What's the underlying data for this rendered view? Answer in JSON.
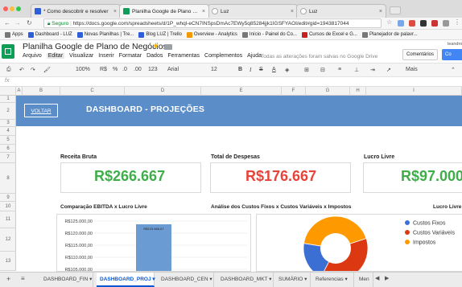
{
  "browser": {
    "tabs": [
      {
        "title": "* Como descobrir e resolver",
        "color": "#2f5fd8"
      },
      {
        "title": "Planilha Google de Plano de N",
        "color": "#0f9d58"
      },
      {
        "title": "Luz",
        "color": "#b0b0b0"
      },
      {
        "title": "Luz",
        "color": "#b0b0b0"
      }
    ],
    "secure_label": "Seguro",
    "url": "https://docs.google.com/spreadsheets/d/1P_whql-eCN7INSpsDmAc7EWy5q85284jjk1IGSFYAOI/edit#gid=1943817044",
    "bookmarks": [
      {
        "label": "Apps",
        "color": "#777"
      },
      {
        "label": "Dashboard - LUZ",
        "color": "#2f5fd8"
      },
      {
        "label": "Novas Planilhas | Tre...",
        "color": "#2f5fd8"
      },
      {
        "label": "Blog LUZ | Trello",
        "color": "#2f5fd8"
      },
      {
        "label": "Overview - Analytics",
        "color": "#f29900"
      },
      {
        "label": "Início - Painel do Co...",
        "color": "#777"
      },
      {
        "label": "Cursos de Excel e G...",
        "color": "#c5221f"
      },
      {
        "label": "Planejador de palavr...",
        "color": "#777"
      }
    ]
  },
  "sheets": {
    "doc_title": "Planilha Google de Plano de Negócios",
    "menus": [
      "Arquivo",
      "Editar",
      "Visualizar",
      "Inserir",
      "Formatar",
      "Dados",
      "Ferramentas",
      "Complementos",
      "Ajuda"
    ],
    "saved_msg": "Todas as alterações foram salvas no Google Drive",
    "comments_label": "Comentários",
    "share_label": "Co",
    "user_label": "leandro"
  },
  "toolbar": {
    "zoom": "100%",
    "currency": "R$",
    "percent": "%",
    "decimals_dec": ".0",
    "decimals_inc": ".00",
    "format_num": "123",
    "font": "Arial",
    "font_size": "12",
    "more": "Mais"
  },
  "grid": {
    "fx": "fx",
    "columns": [
      "A",
      "B",
      "C",
      "D",
      "E",
      "F",
      "G",
      "H",
      "I"
    ],
    "rows": [
      "1",
      "2",
      "3",
      "4",
      "5",
      "6",
      "7",
      "8",
      "9",
      "10",
      "11",
      "12",
      "13"
    ]
  },
  "dashboard": {
    "voltar": "VOLTAR",
    "title": "DASHBOARD - PROJEÇÕES",
    "kpis": [
      {
        "label": "Receita Bruta",
        "value": "R$266.667",
        "color": "#3fae49"
      },
      {
        "label": "Total de Despesas",
        "value": "R$176.667",
        "color": "#e8433a"
      },
      {
        "label": "Lucro Livre",
        "value": "R$97.000",
        "color": "#3fae49"
      }
    ],
    "chart_titles": {
      "ebitda": "Comparação EBITDA x Lucro Livre",
      "costs": "Análise dos Custos Fixos x Custos Variáveis x Impostos",
      "lucro": "Lucro Livre"
    }
  },
  "chart_data": [
    {
      "type": "bar",
      "title": "Comparação EBITDA x Lucro Livre",
      "y_ticks": [
        "R$125.000,00",
        "R$120.000,00",
        "R$115.000,00",
        "R$110.000,00",
        "R$105.000,00"
      ],
      "ylim": [
        105000,
        125000
      ],
      "bar_label": "R$123.666,67",
      "values": [
        123666.67
      ]
    },
    {
      "type": "pie",
      "title": "Análise dos Custos Fixos x Custos Variáveis x Impostos",
      "legend": [
        {
          "name": "Custos Fixos",
          "color": "#3b6fd4"
        },
        {
          "name": "Custos Variáveis",
          "color": "#dc3912"
        },
        {
          "name": "Impostos",
          "color": "#ff9900"
        }
      ],
      "legend_position": "right"
    }
  ],
  "sheet_tabs": [
    "DASHBOARD_FIN",
    "DASHBOARD_PROJ",
    "DASHBOARD_CEN",
    "DASHBOARD_MKT",
    "SUMÁRIO",
    "Referencias",
    "Men"
  ],
  "active_sheet": 1
}
